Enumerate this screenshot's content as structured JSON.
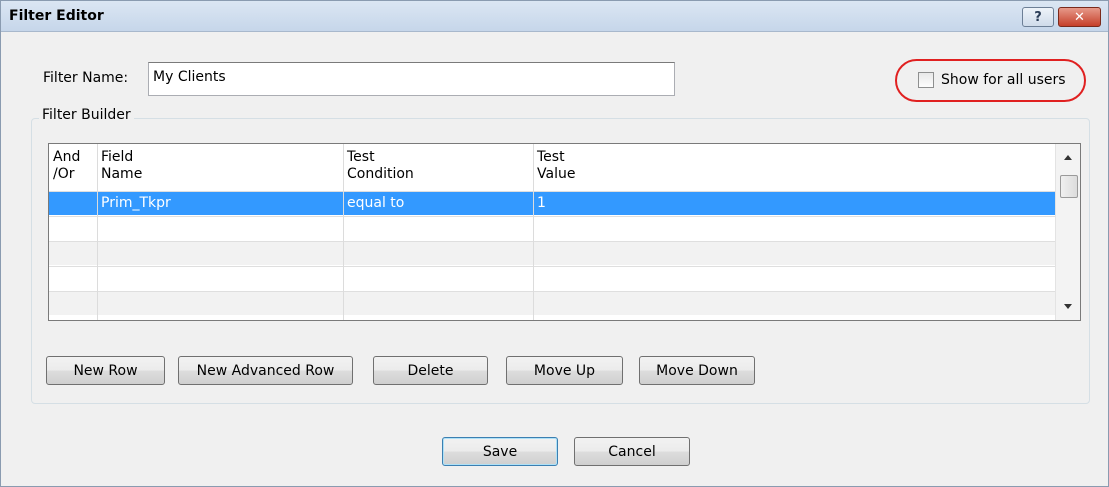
{
  "window": {
    "title": "Filter Editor",
    "help_glyph": "?",
    "close_glyph": "✕"
  },
  "filter": {
    "name_label": "Filter Name:",
    "name_value": "My Clients",
    "show_all_label": "Show for all users",
    "show_all_checked": false
  },
  "builder": {
    "caption": "Filter Builder",
    "columns": [
      {
        "line1": "And",
        "line2": "/Or"
      },
      {
        "line1": "Field",
        "line2": "Name"
      },
      {
        "line1": "Test",
        "line2": "Condition"
      },
      {
        "line1": "Test",
        "line2": "Value"
      }
    ],
    "rows": [
      {
        "andor": "",
        "field": "Prim_Tkpr",
        "condition": "equal to",
        "value": "1",
        "selected": true
      },
      {
        "andor": "",
        "field": "",
        "condition": "",
        "value": "",
        "selected": false
      },
      {
        "andor": "",
        "field": "",
        "condition": "",
        "value": "",
        "selected": false
      },
      {
        "andor": "",
        "field": "",
        "condition": "",
        "value": "",
        "selected": false
      },
      {
        "andor": "",
        "field": "",
        "condition": "",
        "value": "",
        "selected": false
      }
    ],
    "buttons": {
      "new_row": "New Row",
      "new_advanced_row": "New Advanced Row",
      "delete": "Delete",
      "move_up": "Move Up",
      "move_down": "Move Down"
    }
  },
  "footer": {
    "save": "Save",
    "cancel": "Cancel"
  },
  "colors": {
    "selection": "#3399ff",
    "highlight_oval": "#e02020"
  }
}
